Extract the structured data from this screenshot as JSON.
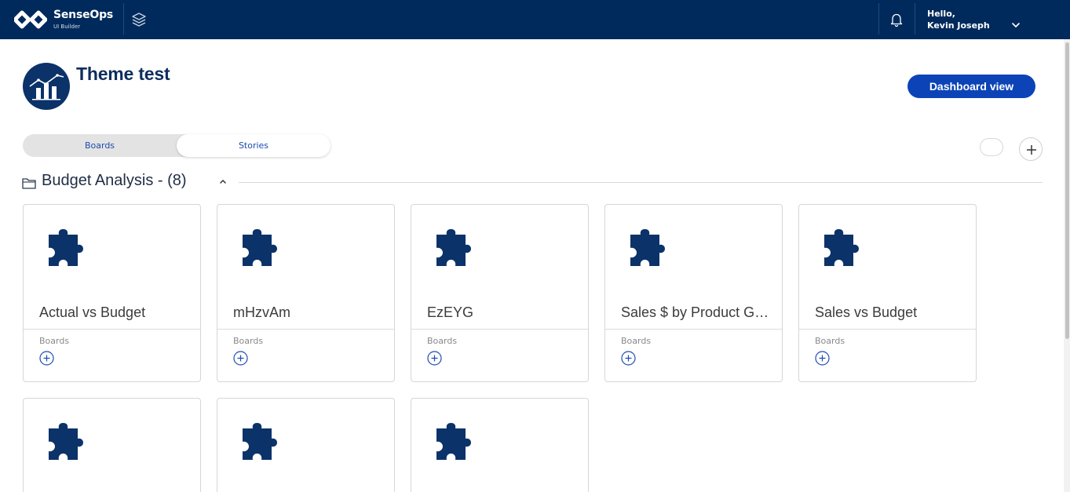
{
  "brand": {
    "name": "SenseOps",
    "subtitle": "UI Builder"
  },
  "user": {
    "greeting": "Hello,",
    "name": "Kevin Joseph"
  },
  "header": {
    "title": "Theme test",
    "dashboard_button": "Dashboard view"
  },
  "tabs": [
    {
      "label": "Boards"
    },
    {
      "label": "Stories"
    }
  ],
  "section": {
    "title": "Budget Analysis - (8)"
  },
  "cards": [
    {
      "title": "Actual vs Budget",
      "subtitle": "Boards"
    },
    {
      "title": "mHzvAm",
      "subtitle": "Boards"
    },
    {
      "title": "EzEYG",
      "subtitle": "Boards"
    },
    {
      "title": "Sales $ by Product Group",
      "subtitle": "Boards"
    },
    {
      "title": "Sales vs Budget",
      "subtitle": "Boards"
    },
    {
      "title": "",
      "subtitle": ""
    },
    {
      "title": "",
      "subtitle": ""
    },
    {
      "title": "",
      "subtitle": ""
    }
  ],
  "icons": {
    "logo": "senseops-logo-icon",
    "layers": "layers-icon",
    "bell": "bell-icon",
    "chevron": "chevron-down-icon",
    "folder": "folder-icon",
    "puzzle": "puzzle-icon",
    "add": "plus-circle-icon"
  },
  "colors": {
    "primary": "#002a5c",
    "accent": "#0c44b7",
    "icon": "#0b3269"
  }
}
